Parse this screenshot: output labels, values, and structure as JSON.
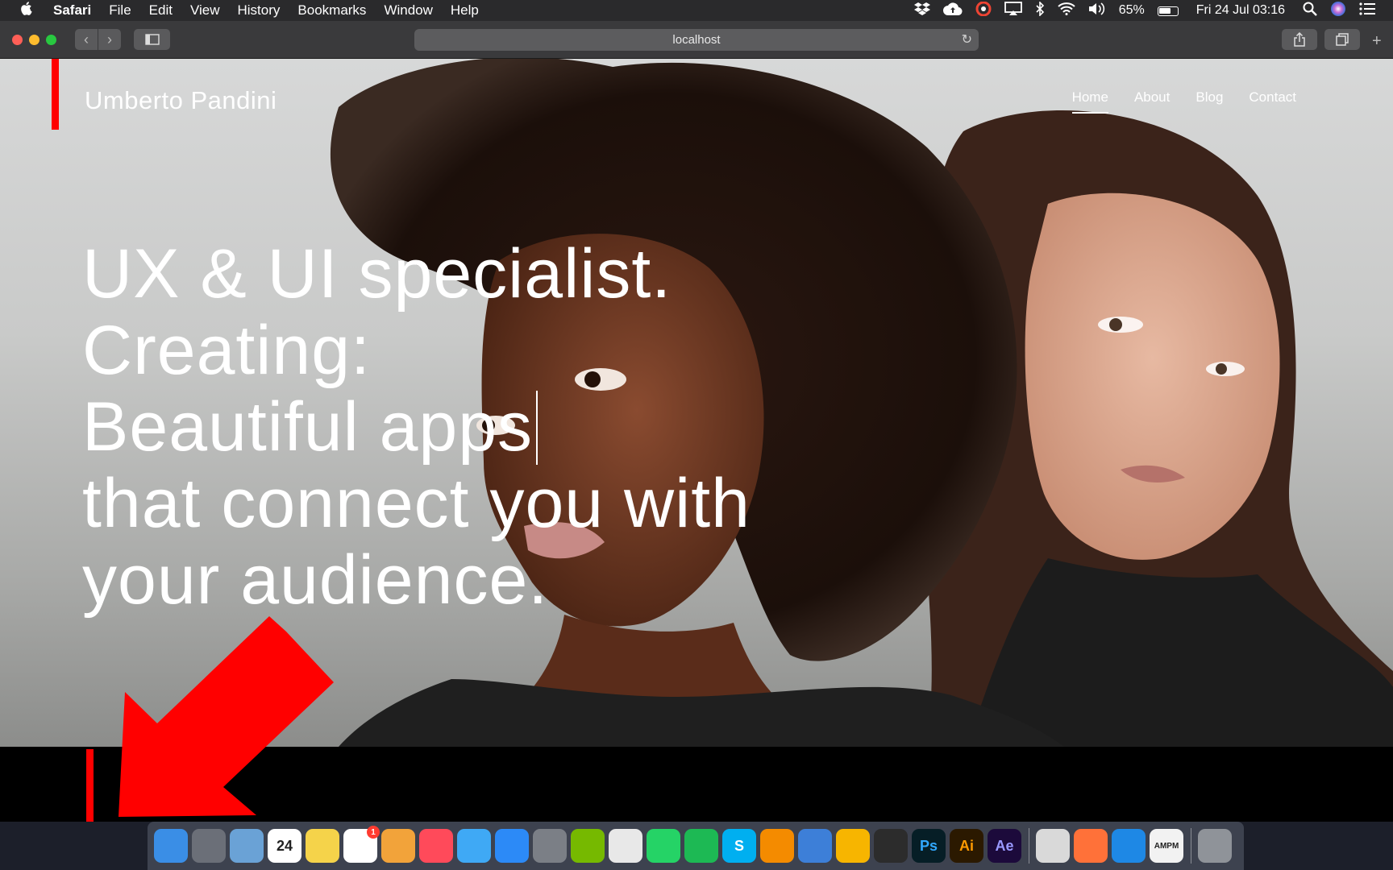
{
  "menubar": {
    "apple": "",
    "app_name": "Safari",
    "menus": [
      "File",
      "Edit",
      "View",
      "History",
      "Bookmarks",
      "Window",
      "Help"
    ],
    "battery": "65%",
    "datetime": "Fri 24 Jul 03:16",
    "status_icons": [
      "dropbox-icon",
      "cloud-upload-icon",
      "creative-cloud-icon",
      "airplay-icon",
      "bluetooth-icon",
      "wifi-icon",
      "volume-icon",
      "battery-icon",
      "spotlight-icon",
      "siri-icon",
      "notification-center-icon"
    ]
  },
  "browser": {
    "url": "localhost",
    "reload_glyph": "↻",
    "back_glyph": "‹",
    "forward_glyph": "›",
    "share_glyph": "⇪",
    "tabs_glyph": "⧉",
    "new_tab_glyph": "+"
  },
  "site": {
    "brand": "Umberto Pandini",
    "nav": [
      "Home",
      "About",
      "Blog",
      "Contact"
    ],
    "active_nav": "Home",
    "headline": [
      "UX & UI specialist.",
      "Creating:",
      "Beautiful apps",
      "that connect you with",
      "your audience."
    ],
    "accent_color": "#ff0000"
  },
  "dock": {
    "items": [
      {
        "name": "finder-icon",
        "label": "",
        "color": "#3a8ee6"
      },
      {
        "name": "launchpad-icon",
        "label": "",
        "color": "#6b6f78"
      },
      {
        "name": "preview-icon",
        "label": "",
        "color": "#6aa2d6"
      },
      {
        "name": "calendar-icon",
        "label": "24",
        "color": "#ffffff"
      },
      {
        "name": "notes-icon",
        "label": "",
        "color": "#f5d34a"
      },
      {
        "name": "reminders-icon",
        "label": "",
        "color": "#ffffff",
        "badge": "1"
      },
      {
        "name": "photos-icon",
        "label": "",
        "color": "#f2a33a"
      },
      {
        "name": "news-icon",
        "label": "",
        "color": "#ff4a5a"
      },
      {
        "name": "messages-icon",
        "label": "",
        "color": "#3fa9f5"
      },
      {
        "name": "app-store-icon",
        "label": "",
        "color": "#2c8af7"
      },
      {
        "name": "system-preferences-icon",
        "label": "",
        "color": "#7b7f86"
      },
      {
        "name": "nvidia-icon",
        "label": "",
        "color": "#76b900"
      },
      {
        "name": "chrome-icon",
        "label": "",
        "color": "#e8e8e8"
      },
      {
        "name": "whatsapp-icon",
        "label": "",
        "color": "#25d366"
      },
      {
        "name": "spotify-icon",
        "label": "",
        "color": "#1db954"
      },
      {
        "name": "skype-icon",
        "label": "S",
        "color": "#00aff0"
      },
      {
        "name": "vlc-icon",
        "label": "",
        "color": "#f48b00"
      },
      {
        "name": "mail-icon",
        "label": "",
        "color": "#3d7fd8"
      },
      {
        "name": "sketch-icon",
        "label": "",
        "color": "#f7b500"
      },
      {
        "name": "figma-icon",
        "label": "",
        "color": "#2c2c2c"
      },
      {
        "name": "photoshop-icon",
        "label": "Ps",
        "color": "#061e26"
      },
      {
        "name": "illustrator-icon",
        "label": "Ai",
        "color": "#2b1900"
      },
      {
        "name": "after-effects-icon",
        "label": "Ae",
        "color": "#1c0a3b"
      },
      {
        "name": "sequel-pro-icon",
        "label": "",
        "color": "#d9d9d9"
      },
      {
        "name": "firefox-icon",
        "label": "",
        "color": "#ff7139"
      },
      {
        "name": "safari-icon",
        "label": "",
        "color": "#1e88e5"
      },
      {
        "name": "ampm-icon",
        "label": "AMPM",
        "color": "#f2f2f2"
      },
      {
        "name": "trash-icon",
        "label": "",
        "color": "#8f9399"
      }
    ]
  }
}
